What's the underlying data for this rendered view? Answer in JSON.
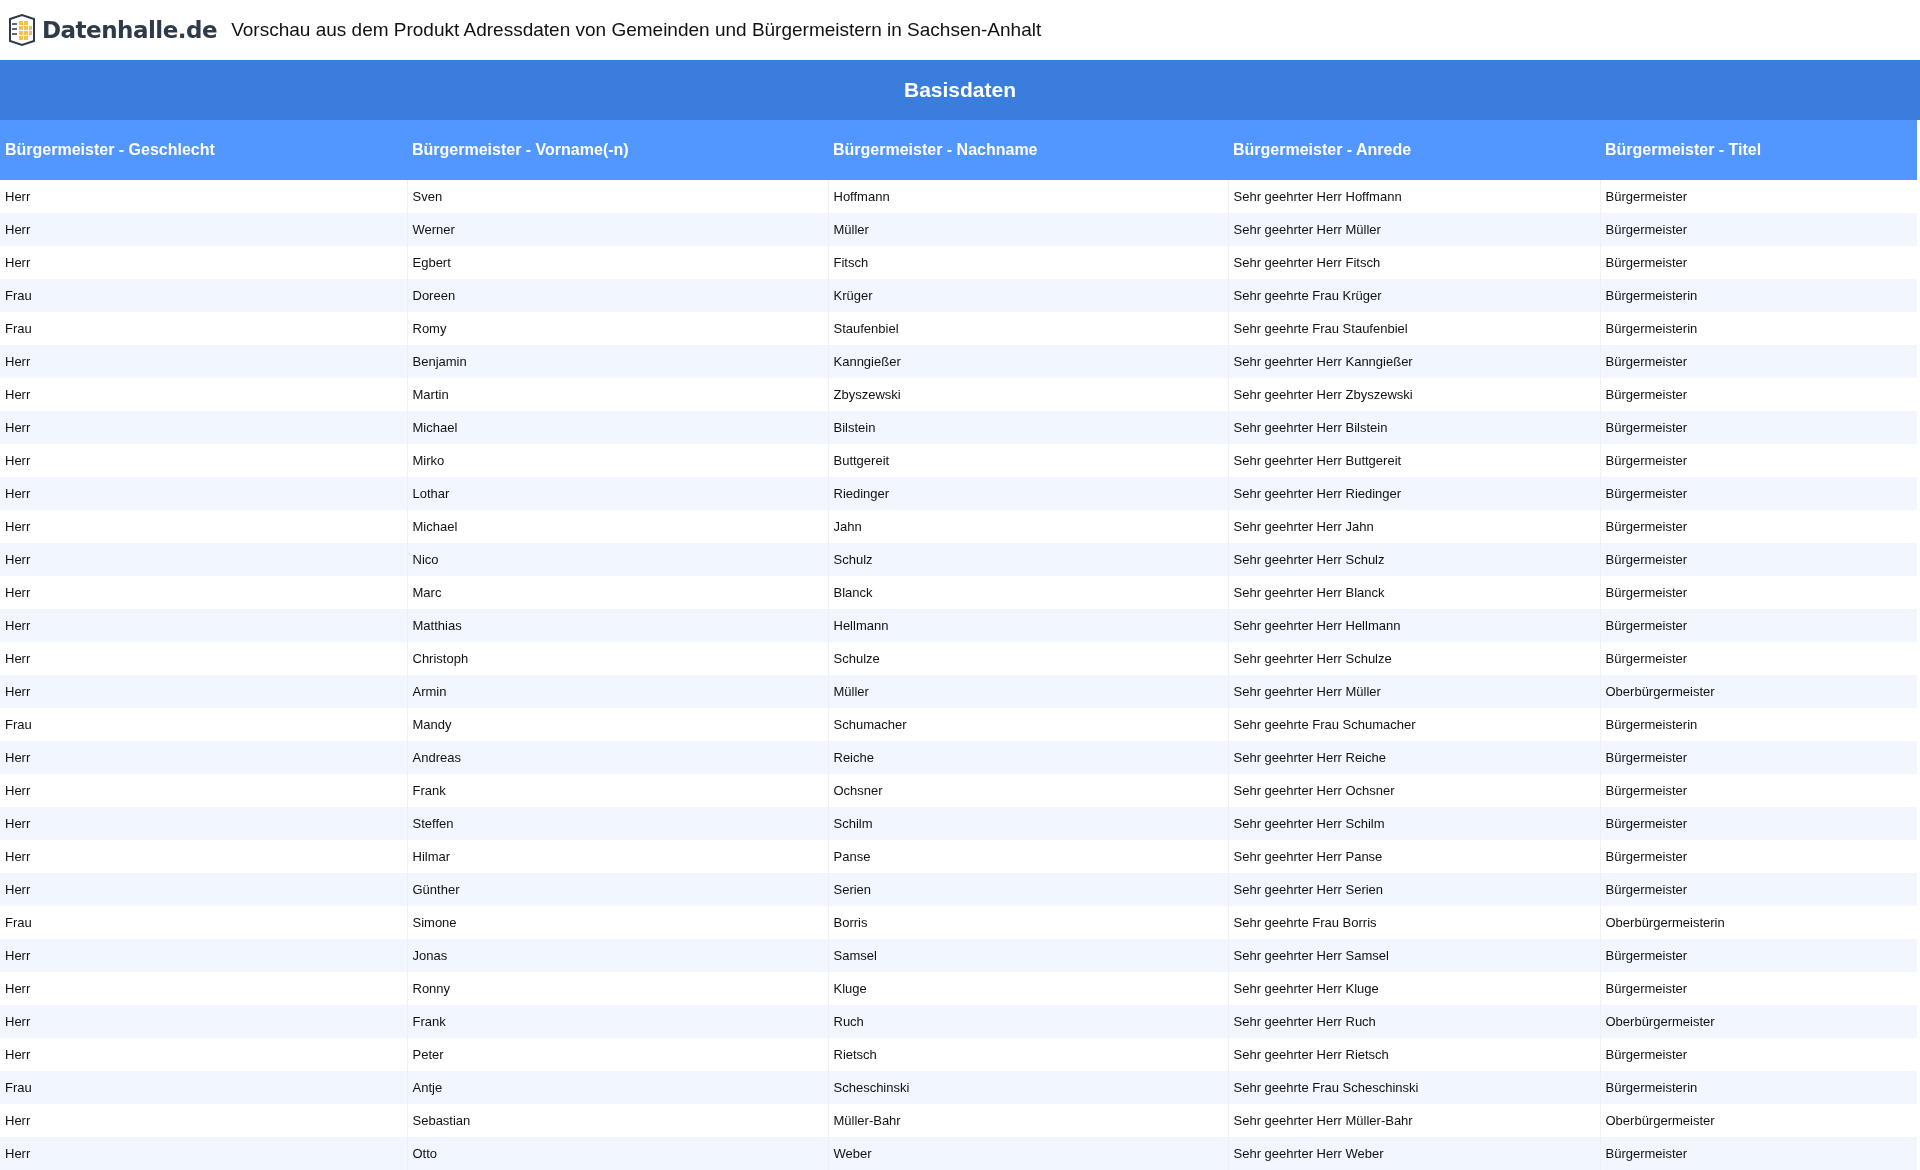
{
  "header": {
    "logo_text": "Datenhalle.de",
    "title": "Vorschau aus dem Produkt Adressdaten von Gemeinden und Bürgermeistern in Sachsen-Anhalt"
  },
  "section_title": "Basisdaten",
  "table": {
    "columns": [
      "Bürgermeister - Geschlecht",
      "Bürgermeister - Vorname(-n)",
      "Bürgermeister - Nachname",
      "Bürgermeister - Anrede",
      "Bürgermeister - Titel"
    ],
    "rows": [
      [
        "Herr",
        "Sven",
        "Hoffmann",
        "Sehr geehrter Herr Hoffmann",
        "Bürgermeister"
      ],
      [
        "Herr",
        "Werner",
        "Müller",
        "Sehr geehrter Herr Müller",
        "Bürgermeister"
      ],
      [
        "Herr",
        "Egbert",
        "Fitsch",
        "Sehr geehrter Herr Fitsch",
        "Bürgermeister"
      ],
      [
        "Frau",
        "Doreen",
        "Krüger",
        "Sehr geehrte Frau Krüger",
        "Bürgermeisterin"
      ],
      [
        "Frau",
        "Romy",
        "Staufenbiel",
        "Sehr geehrte Frau Staufenbiel",
        "Bürgermeisterin"
      ],
      [
        "Herr",
        "Benjamin",
        "Kanngießer",
        "Sehr geehrter Herr Kanngießer",
        "Bürgermeister"
      ],
      [
        "Herr",
        "Martin",
        "Zbyszewski",
        "Sehr geehrter Herr Zbyszewski",
        "Bürgermeister"
      ],
      [
        "Herr",
        "Michael",
        "Bilstein",
        "Sehr geehrter Herr Bilstein",
        "Bürgermeister"
      ],
      [
        "Herr",
        "Mirko",
        "Buttgereit",
        "Sehr geehrter Herr Buttgereit",
        "Bürgermeister"
      ],
      [
        "Herr",
        "Lothar",
        "Riedinger",
        "Sehr geehrter Herr Riedinger",
        "Bürgermeister"
      ],
      [
        "Herr",
        "Michael",
        "Jahn",
        "Sehr geehrter Herr Jahn",
        "Bürgermeister"
      ],
      [
        "Herr",
        "Nico",
        "Schulz",
        "Sehr geehrter Herr Schulz",
        "Bürgermeister"
      ],
      [
        "Herr",
        "Marc",
        "Blanck",
        "Sehr geehrter Herr Blanck",
        "Bürgermeister"
      ],
      [
        "Herr",
        "Matthias",
        "Hellmann",
        "Sehr geehrter Herr Hellmann",
        "Bürgermeister"
      ],
      [
        "Herr",
        "Christoph",
        "Schulze",
        "Sehr geehrter Herr Schulze",
        "Bürgermeister"
      ],
      [
        "Herr",
        "Armin",
        "Müller",
        "Sehr geehrter Herr Müller",
        "Oberbürgermeister"
      ],
      [
        "Frau",
        "Mandy",
        "Schumacher",
        "Sehr geehrte Frau Schumacher",
        "Bürgermeisterin"
      ],
      [
        "Herr",
        "Andreas",
        "Reiche",
        "Sehr geehrter Herr Reiche",
        "Bürgermeister"
      ],
      [
        "Herr",
        "Frank",
        "Ochsner",
        "Sehr geehrter Herr Ochsner",
        "Bürgermeister"
      ],
      [
        "Herr",
        "Steffen",
        "Schilm",
        "Sehr geehrter Herr Schilm",
        "Bürgermeister"
      ],
      [
        "Herr",
        "Hilmar",
        "Panse",
        "Sehr geehrter Herr Panse",
        "Bürgermeister"
      ],
      [
        "Herr",
        "Günther",
        "Serien",
        "Sehr geehrter Herr Serien",
        "Bürgermeister"
      ],
      [
        "Frau",
        "Simone",
        "Borris",
        "Sehr geehrte Frau Borris",
        "Oberbürgermeisterin"
      ],
      [
        "Herr",
        "Jonas",
        "Samsel",
        "Sehr geehrter Herr Samsel",
        "Bürgermeister"
      ],
      [
        "Herr",
        "Ronny",
        "Kluge",
        "Sehr geehrter Herr Kluge",
        "Bürgermeister"
      ],
      [
        "Herr",
        "Frank",
        "Ruch",
        "Sehr geehrter Herr Ruch",
        "Oberbürgermeister"
      ],
      [
        "Herr",
        "Peter",
        "Rietsch",
        "Sehr geehrter Herr Rietsch",
        "Bürgermeister"
      ],
      [
        "Frau",
        "Antje",
        "Scheschinski",
        "Sehr geehrte Frau Scheschinski",
        "Bürgermeisterin"
      ],
      [
        "Herr",
        "Sebastian",
        "Müller-Bahr",
        "Sehr geehrter Herr Müller-Bahr",
        "Oberbürgermeister"
      ],
      [
        "Herr",
        "Otto",
        "Weber",
        "Sehr geehrter Herr Weber",
        "Bürgermeister"
      ]
    ]
  }
}
